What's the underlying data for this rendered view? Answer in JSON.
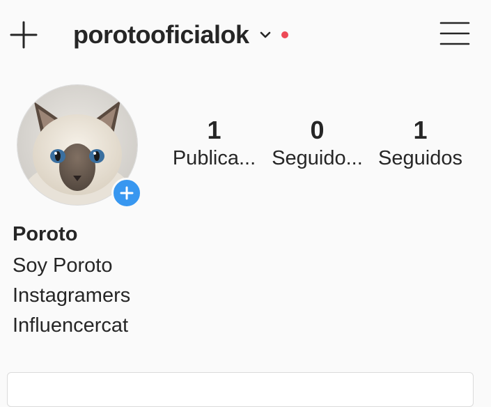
{
  "header": {
    "username": "porotooficialok",
    "new_post_icon": "plus-icon",
    "account_switch_icon": "chevron-down-icon",
    "notification_dot_color": "#ed4956",
    "menu_icon": "hamburger-menu-icon"
  },
  "profile": {
    "avatar_icon": "cat-avatar",
    "add_story_color": "#3897f0"
  },
  "stats": [
    {
      "count": "1",
      "label": "Publica..."
    },
    {
      "count": "0",
      "label": "Seguido..."
    },
    {
      "count": "1",
      "label": "Seguidos"
    }
  ],
  "bio": {
    "name": "Poroto",
    "lines": [
      "Soy Poroto",
      "Instagramers",
      "Influencercat"
    ]
  }
}
